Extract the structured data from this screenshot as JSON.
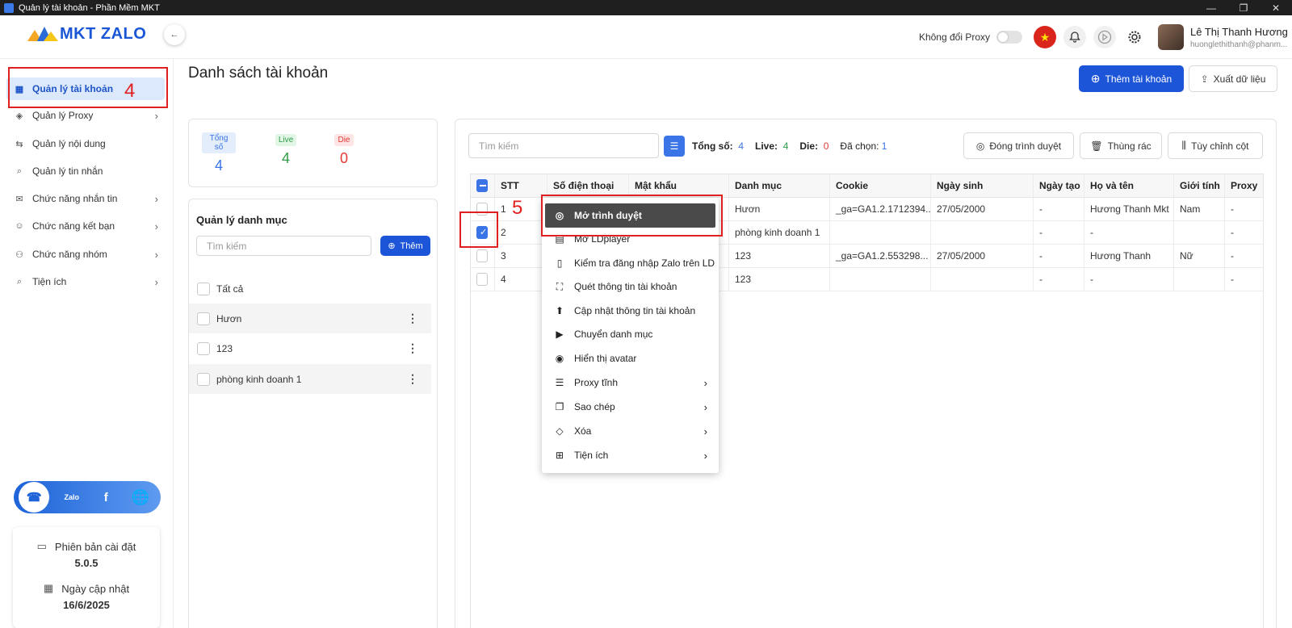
{
  "window": {
    "title": "Quản lý tài khoản - Phần Mềm MKT",
    "controls": [
      "—",
      "❐",
      "✕"
    ]
  },
  "header": {
    "logo_text": "MKT ZALO",
    "proxy_toggle_label": "Không đổi Proxy",
    "user": {
      "name": "Lê Thị Thanh Hương",
      "email": "huonglethithanh@phanm..."
    }
  },
  "sidebar": {
    "items": [
      {
        "label": "Quản lý tài khoản",
        "icon": "grid-icon",
        "glyph": "▦",
        "has_children": false
      },
      {
        "label": "Quản lý Proxy",
        "icon": "layers-icon",
        "glyph": "◈",
        "has_children": true
      },
      {
        "label": "Quản lý nội dung",
        "icon": "swap-icon",
        "glyph": "⇆",
        "has_children": false
      },
      {
        "label": "Quản lý tin nhắn",
        "icon": "search-icon",
        "glyph": "⌕",
        "has_children": false
      },
      {
        "label": "Chức năng nhắn tin",
        "icon": "chat-icon",
        "glyph": "✉",
        "has_children": true
      },
      {
        "label": "Chức năng kết bạn",
        "icon": "add-user-icon",
        "glyph": "☺",
        "has_children": true
      },
      {
        "label": "Chức năng nhóm",
        "icon": "group-icon",
        "glyph": "⚇",
        "has_children": true
      },
      {
        "label": "Tiện ích",
        "icon": "search-icon",
        "glyph": "⌕",
        "has_children": true
      }
    ],
    "social": [
      "support-icon",
      "zalo-icon",
      "facebook-icon",
      "globe-icon"
    ],
    "social_glyphs": {
      "zalo": "Zalo",
      "facebook": "f",
      "globe": "🌐"
    },
    "version_label": "Phiên bản cài đặt",
    "version": "5.0.5",
    "update_label": "Ngày cập nhật",
    "update_date": "16/6/2025"
  },
  "main": {
    "title": "Danh sách tài khoản",
    "add_account_button": "Thêm tài khoản",
    "export_button": "Xuất dữ liệu"
  },
  "stats": {
    "total_label": "Tổng số",
    "total": "4",
    "live_label": "Live",
    "live": "4",
    "die_label": "Die",
    "die": "0"
  },
  "categories": {
    "title": "Quản lý danh mục",
    "search_placeholder": "Tìm kiếm",
    "add_button": "Thêm",
    "items": [
      "Tất cả",
      "Hươn",
      "123",
      "phòng kinh doanh 1"
    ]
  },
  "toolbar": {
    "search_placeholder": "Tìm kiếm",
    "total_label": "Tổng số:",
    "total": "4",
    "live_label": "Live:",
    "live": "4",
    "die_label": "Die:",
    "die": "0",
    "selected_label": "Đã chọn:",
    "selected": "1",
    "close_browser_button": "Đóng trình duyệt",
    "trash_button": "Thùng rác",
    "customize_columns_button": "Tùy chỉnh cột"
  },
  "table": {
    "columns": [
      "STT",
      "Số điện thoại",
      "Mật khẩu",
      "Danh mục",
      "Cookie",
      "Ngày sinh",
      "Ngày tạo",
      "Họ và tên",
      "Giới tính",
      "Proxy"
    ],
    "rows": [
      {
        "checked": false,
        "cells": [
          "1",
          "",
          "",
          "Hươn",
          "_ga=GA1.2.1712394...",
          "27/05/2000",
          "-",
          "Hương Thanh Mkt",
          "Nam",
          "-"
        ]
      },
      {
        "checked": true,
        "cells": [
          "2",
          "",
          "",
          "phòng kinh doanh 1",
          "",
          "",
          "-",
          "-",
          "",
          "-"
        ]
      },
      {
        "checked": false,
        "cells": [
          "3",
          "",
          "",
          "123",
          "_ga=GA1.2.553298...",
          "27/05/2000",
          "-",
          "Hương Thanh",
          "Nữ",
          "-"
        ]
      },
      {
        "checked": false,
        "cells": [
          "4",
          "",
          "",
          "123",
          "",
          "",
          "-",
          "-",
          "",
          "-"
        ]
      }
    ]
  },
  "context_menu": {
    "items": [
      {
        "label": "Mở trình duyệt",
        "icon": "chrome-icon",
        "glyph": "◎",
        "submenu": false,
        "highlighted": true
      },
      {
        "label": "Mở LDplayer",
        "icon": "ldplayer-icon",
        "glyph": "▤",
        "submenu": false
      },
      {
        "label": "Kiểm tra đăng nhập Zalo trên LD",
        "icon": "phone-check-icon",
        "glyph": "▯",
        "submenu": false
      },
      {
        "label": "Quét thông tin tài khoản",
        "icon": "scan-icon",
        "glyph": "⛶",
        "submenu": false
      },
      {
        "label": "Cập nhật thông tin tài khoản",
        "icon": "upload-icon",
        "glyph": "⬆",
        "submenu": false
      },
      {
        "label": "Chuyển danh mục",
        "icon": "folder-move-icon",
        "glyph": "▶",
        "submenu": false
      },
      {
        "label": "Hiển thị avatar",
        "icon": "user-circle-icon",
        "glyph": "◉",
        "submenu": false
      },
      {
        "label": "Proxy tĩnh",
        "icon": "server-icon",
        "glyph": "☰",
        "submenu": true
      },
      {
        "label": "Sao chép",
        "icon": "copy-icon",
        "glyph": "❐",
        "submenu": true
      },
      {
        "label": "Xóa",
        "icon": "eraser-icon",
        "glyph": "◇",
        "submenu": true
      },
      {
        "label": "Tiện ích",
        "icon": "widgets-icon",
        "glyph": "⊞",
        "submenu": true
      }
    ]
  },
  "annotations": {
    "marker_4": "4",
    "marker_5": "5"
  },
  "colors": {
    "accent": "#1d55d9",
    "live": "#2e9b46",
    "die": "#e53935",
    "annotation": "#e02020"
  }
}
